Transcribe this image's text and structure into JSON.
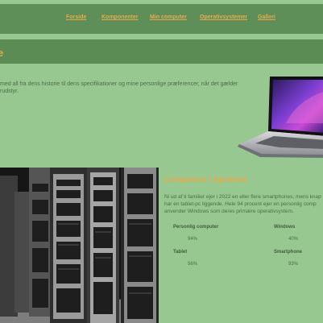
{
  "nav": {
    "items": [
      "Forside",
      "Komponenter",
      "Min computer",
      "Operativsystemer",
      "Galleri"
    ]
  },
  "banner": {
    "title": "re"
  },
  "intro": {
    "lines": [
      "med all fra dens historie til dens specifikationer og mine personlige præferencer, når det gælder",
      "rudstyr."
    ]
  },
  "section": {
    "title": "Computere i hjemmet",
    "lines": [
      "Ni ud af ti familier ejer i 2022 en eller flere smartphones, mens knap",
      "har en tablet-pc liggende. Hele 94 procent ejer en personlig comp",
      "anvender Windows som deres primære operativsystem."
    ]
  },
  "stats": {
    "pc_label": "Personlig computer",
    "pc_value": "94%",
    "windows_label": "Windows",
    "windows_value": "40%",
    "tablet_label": "Tablet",
    "tablet_value": "56%",
    "smartphone_label": "Smartphone",
    "smartphone_value": "93%"
  },
  "colors": {
    "background": "#97c890",
    "nav": "#5f8f58",
    "accent": "#e8a94b",
    "text": "#4d6f47"
  },
  "icons": {
    "laptop_image": "laptop-image",
    "server_image": "server-room-image"
  }
}
